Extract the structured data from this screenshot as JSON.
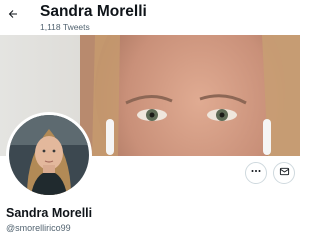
{
  "header": {
    "title": "Sandra Morelli",
    "tweet_count": "1,118 Tweets",
    "back_icon": "arrow-left-icon"
  },
  "banner": {
    "description_icon": "banner-photo"
  },
  "actions": {
    "more_icon": "more-horizontal-icon",
    "message_icon": "envelope-icon"
  },
  "profile": {
    "name": "Sandra Morelli",
    "handle": "@smorellirico99"
  },
  "colors": {
    "text_primary": "#0f1419",
    "text_secondary": "#536471",
    "border": "#cfd9de",
    "background": "#ffffff"
  }
}
